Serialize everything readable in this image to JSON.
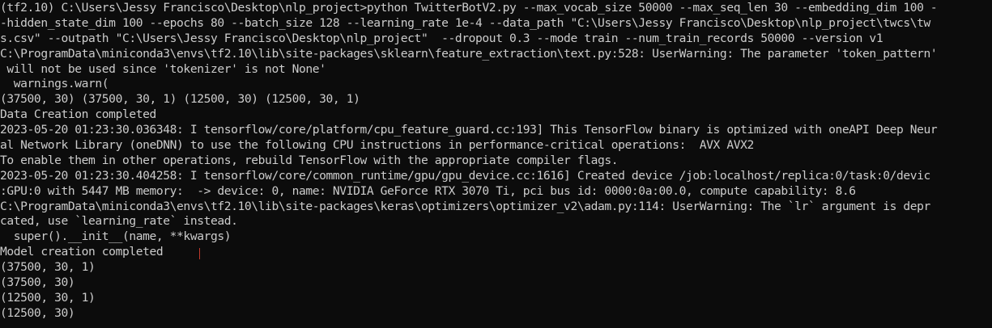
{
  "terminal": {
    "lines": [
      "(tf2.10) C:\\Users\\Jessy Francisco\\Desktop\\nlp_project>python TwitterBotV2.py --max_vocab_size 50000 --max_seq_len 30 --embedding_dim 100 -",
      "-hidden_state_dim 100 --epochs 80 --batch_size 128 --learning_rate 1e-4 --data_path \"C:\\Users\\Jessy Francisco\\Desktop\\nlp_project\\twcs\\tw",
      "s.csv\" --outpath \"C:\\Users\\Jessy Francisco\\Desktop\\nlp_project\"  --dropout 0.3 --mode train --num_train_records 50000 --version v1",
      "C:\\ProgramData\\miniconda3\\envs\\tf2.10\\lib\\site-packages\\sklearn\\feature_extraction\\text.py:528: UserWarning: The parameter 'token_pattern'",
      " will not be used since 'tokenizer' is not None'",
      "  warnings.warn(",
      "(37500, 30) (37500, 30, 1) (12500, 30) (12500, 30, 1)",
      "Data Creation completed",
      "2023-05-20 01:23:30.036348: I tensorflow/core/platform/cpu_feature_guard.cc:193] This TensorFlow binary is optimized with oneAPI Deep Neur",
      "al Network Library (oneDNN) to use the following CPU instructions in performance-critical operations:  AVX AVX2",
      "To enable them in other operations, rebuild TensorFlow with the appropriate compiler flags.",
      "2023-05-20 01:23:30.404258: I tensorflow/core/common_runtime/gpu/gpu_device.cc:1616] Created device /job:localhost/replica:0/task:0/devic",
      ":GPU:0 with 5447 MB memory:  -> device: 0, name: NVIDIA GeForce RTX 3070 Ti, pci bus id: 0000:0a:00.0, compute capability: 8.6",
      "C:\\ProgramData\\miniconda3\\envs\\tf2.10\\lib\\site-packages\\keras\\optimizers\\optimizer_v2\\adam.py:114: UserWarning: The `lr` argument is depr",
      "cated, use `learning_rate` instead.",
      "  super().__init__(name, **kwargs)",
      "Model creation completed",
      "(37500, 30, 1)",
      "(37500, 30)",
      "(12500, 30, 1)",
      "(12500, 30)"
    ]
  },
  "colors": {
    "background": "#0c0c0c",
    "foreground": "#cccccc",
    "cursor": "#c0392b"
  }
}
